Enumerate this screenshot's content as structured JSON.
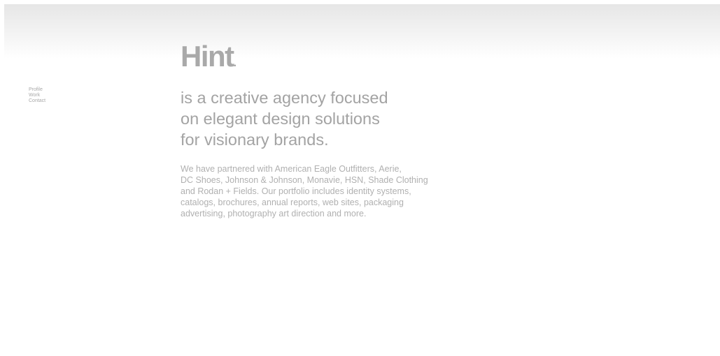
{
  "nav": {
    "items": [
      {
        "label": "Profile"
      },
      {
        "label": "Work"
      },
      {
        "label": "Contact"
      }
    ]
  },
  "logo": {
    "text": "Hint",
    "dot": "."
  },
  "tagline": {
    "lines": [
      "is a creative agency focused",
      "on elegant design solutions",
      "for visionary brands."
    ]
  },
  "body": {
    "lines": [
      "We have partnered with American Eagle Outfitters, Aerie,",
      "DC Shoes, Johnson & Johnson, Monavie, HSN, Shade Clothing",
      "and Rodan + Fields. Our portfolio includes identity systems,",
      "catalogs, brochures, annual reports, web sites, packaging",
      "advertising, photography art direction and more."
    ]
  },
  "colors": {
    "text_gray": "#a3a3a3",
    "body_gray": "#b0b0b0",
    "background": "#ffffff"
  }
}
